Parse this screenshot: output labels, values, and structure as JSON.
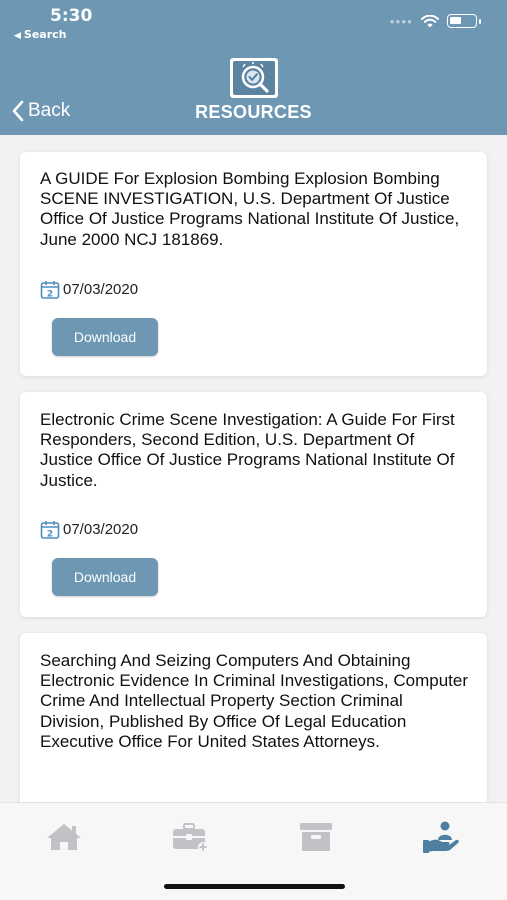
{
  "status_bar": {
    "time": "5:30",
    "back_app": "Search"
  },
  "nav": {
    "back_label": "Back",
    "title": "RESOURCES"
  },
  "resources": [
    {
      "title": "A GUIDE For Explosion Bombing Explosion Bombing SCENE INVESTIGATION, U.S. Department Of Justice Office Of Justice Programs National Institute Of Justice, June 2000 NCJ 181869.",
      "date": "07/03/2020",
      "download_label": "Download"
    },
    {
      "title": "Electronic Crime Scene Investigation: A Guide For First Responders, Second Edition, U.S. Department Of Justice Office Of Justice Programs National Institute Of Justice.",
      "date": "07/03/2020",
      "download_label": "Download"
    },
    {
      "title": "Searching And Seizing Computers And Obtaining Electronic Evidence In Criminal Investigations, Computer Crime And Intellectual Property Section Criminal Division, Published By Office Of Legal Education Executive Office For United States Attorneys.",
      "date": "",
      "download_label": ""
    }
  ],
  "tabbar": {
    "items": [
      {
        "icon": "home-icon",
        "active": false
      },
      {
        "icon": "briefcase-icon",
        "active": false
      },
      {
        "icon": "archive-icon",
        "active": false
      },
      {
        "icon": "resources-hand-icon",
        "active": true
      }
    ]
  },
  "colors": {
    "header": "#6e97b4",
    "tab_inactive": "#c2c2c6",
    "tab_active": "#4f7fa0"
  }
}
